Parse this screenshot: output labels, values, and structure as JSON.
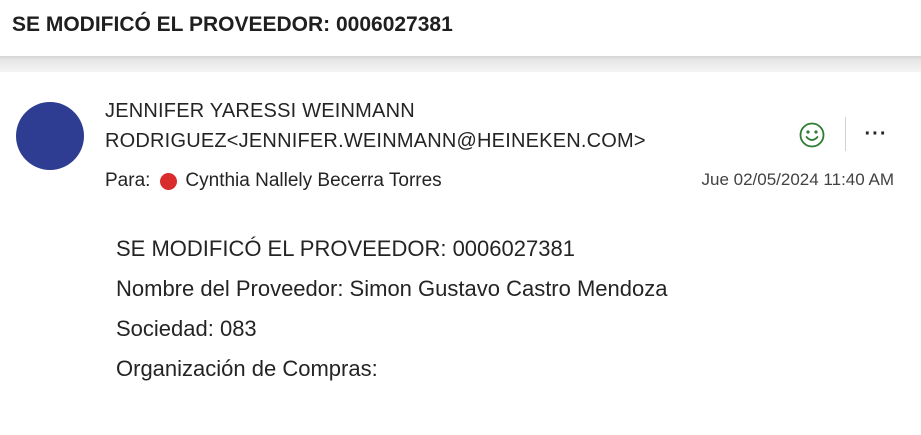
{
  "email": {
    "subject": "SE MODIFICÓ EL PROVEEDOR: 0006027381",
    "sender_line1": "JENNIFER YARESSI WEINMANN",
    "sender_line2": "RODRIGUEZ<JENNIFER.WEINMANN@HEINEKEN.COM>",
    "to_label": "Para:",
    "recipient": "Cynthia Nallely Becerra Torres",
    "date": "Jue 02/05/2024 11:40 AM",
    "avatar_color": "#2e3d91",
    "presence_color": "#d92c2c",
    "body": {
      "line1": "SE MODIFICÓ EL PROVEEDOR: 0006027381",
      "line2": "Nombre del Proveedor: Simon Gustavo Castro Mendoza",
      "line3": "Sociedad: 083",
      "line4": "Organización de Compras:"
    }
  },
  "actions": {
    "react_icon": "smiley-face-icon",
    "more_label": "···",
    "more_icon": "more-options-icon"
  }
}
